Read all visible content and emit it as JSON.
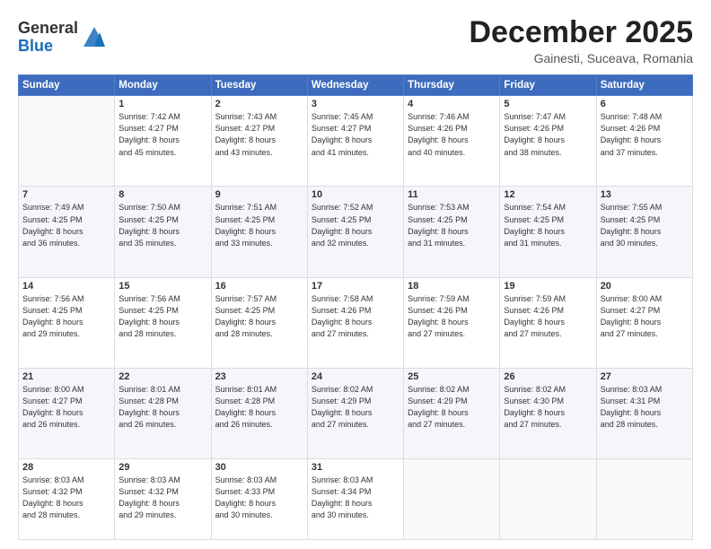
{
  "logo": {
    "general": "General",
    "blue": "Blue"
  },
  "header": {
    "month": "December 2025",
    "location": "Gainesti, Suceava, Romania"
  },
  "weekdays": [
    "Sunday",
    "Monday",
    "Tuesday",
    "Wednesday",
    "Thursday",
    "Friday",
    "Saturday"
  ],
  "weeks": [
    [
      {
        "day": "",
        "info": ""
      },
      {
        "day": "1",
        "info": "Sunrise: 7:42 AM\nSunset: 4:27 PM\nDaylight: 8 hours\nand 45 minutes."
      },
      {
        "day": "2",
        "info": "Sunrise: 7:43 AM\nSunset: 4:27 PM\nDaylight: 8 hours\nand 43 minutes."
      },
      {
        "day": "3",
        "info": "Sunrise: 7:45 AM\nSunset: 4:27 PM\nDaylight: 8 hours\nand 41 minutes."
      },
      {
        "day": "4",
        "info": "Sunrise: 7:46 AM\nSunset: 4:26 PM\nDaylight: 8 hours\nand 40 minutes."
      },
      {
        "day": "5",
        "info": "Sunrise: 7:47 AM\nSunset: 4:26 PM\nDaylight: 8 hours\nand 38 minutes."
      },
      {
        "day": "6",
        "info": "Sunrise: 7:48 AM\nSunset: 4:26 PM\nDaylight: 8 hours\nand 37 minutes."
      }
    ],
    [
      {
        "day": "7",
        "info": "Sunrise: 7:49 AM\nSunset: 4:25 PM\nDaylight: 8 hours\nand 36 minutes."
      },
      {
        "day": "8",
        "info": "Sunrise: 7:50 AM\nSunset: 4:25 PM\nDaylight: 8 hours\nand 35 minutes."
      },
      {
        "day": "9",
        "info": "Sunrise: 7:51 AM\nSunset: 4:25 PM\nDaylight: 8 hours\nand 33 minutes."
      },
      {
        "day": "10",
        "info": "Sunrise: 7:52 AM\nSunset: 4:25 PM\nDaylight: 8 hours\nand 32 minutes."
      },
      {
        "day": "11",
        "info": "Sunrise: 7:53 AM\nSunset: 4:25 PM\nDaylight: 8 hours\nand 31 minutes."
      },
      {
        "day": "12",
        "info": "Sunrise: 7:54 AM\nSunset: 4:25 PM\nDaylight: 8 hours\nand 31 minutes."
      },
      {
        "day": "13",
        "info": "Sunrise: 7:55 AM\nSunset: 4:25 PM\nDaylight: 8 hours\nand 30 minutes."
      }
    ],
    [
      {
        "day": "14",
        "info": "Sunrise: 7:56 AM\nSunset: 4:25 PM\nDaylight: 8 hours\nand 29 minutes."
      },
      {
        "day": "15",
        "info": "Sunrise: 7:56 AM\nSunset: 4:25 PM\nDaylight: 8 hours\nand 28 minutes."
      },
      {
        "day": "16",
        "info": "Sunrise: 7:57 AM\nSunset: 4:25 PM\nDaylight: 8 hours\nand 28 minutes."
      },
      {
        "day": "17",
        "info": "Sunrise: 7:58 AM\nSunset: 4:26 PM\nDaylight: 8 hours\nand 27 minutes."
      },
      {
        "day": "18",
        "info": "Sunrise: 7:59 AM\nSunset: 4:26 PM\nDaylight: 8 hours\nand 27 minutes."
      },
      {
        "day": "19",
        "info": "Sunrise: 7:59 AM\nSunset: 4:26 PM\nDaylight: 8 hours\nand 27 minutes."
      },
      {
        "day": "20",
        "info": "Sunrise: 8:00 AM\nSunset: 4:27 PM\nDaylight: 8 hours\nand 27 minutes."
      }
    ],
    [
      {
        "day": "21",
        "info": "Sunrise: 8:00 AM\nSunset: 4:27 PM\nDaylight: 8 hours\nand 26 minutes."
      },
      {
        "day": "22",
        "info": "Sunrise: 8:01 AM\nSunset: 4:28 PM\nDaylight: 8 hours\nand 26 minutes."
      },
      {
        "day": "23",
        "info": "Sunrise: 8:01 AM\nSunset: 4:28 PM\nDaylight: 8 hours\nand 26 minutes."
      },
      {
        "day": "24",
        "info": "Sunrise: 8:02 AM\nSunset: 4:29 PM\nDaylight: 8 hours\nand 27 minutes."
      },
      {
        "day": "25",
        "info": "Sunrise: 8:02 AM\nSunset: 4:29 PM\nDaylight: 8 hours\nand 27 minutes."
      },
      {
        "day": "26",
        "info": "Sunrise: 8:02 AM\nSunset: 4:30 PM\nDaylight: 8 hours\nand 27 minutes."
      },
      {
        "day": "27",
        "info": "Sunrise: 8:03 AM\nSunset: 4:31 PM\nDaylight: 8 hours\nand 28 minutes."
      }
    ],
    [
      {
        "day": "28",
        "info": "Sunrise: 8:03 AM\nSunset: 4:32 PM\nDaylight: 8 hours\nand 28 minutes."
      },
      {
        "day": "29",
        "info": "Sunrise: 8:03 AM\nSunset: 4:32 PM\nDaylight: 8 hours\nand 29 minutes."
      },
      {
        "day": "30",
        "info": "Sunrise: 8:03 AM\nSunset: 4:33 PM\nDaylight: 8 hours\nand 30 minutes."
      },
      {
        "day": "31",
        "info": "Sunrise: 8:03 AM\nSunset: 4:34 PM\nDaylight: 8 hours\nand 30 minutes."
      },
      {
        "day": "",
        "info": ""
      },
      {
        "day": "",
        "info": ""
      },
      {
        "day": "",
        "info": ""
      }
    ]
  ]
}
